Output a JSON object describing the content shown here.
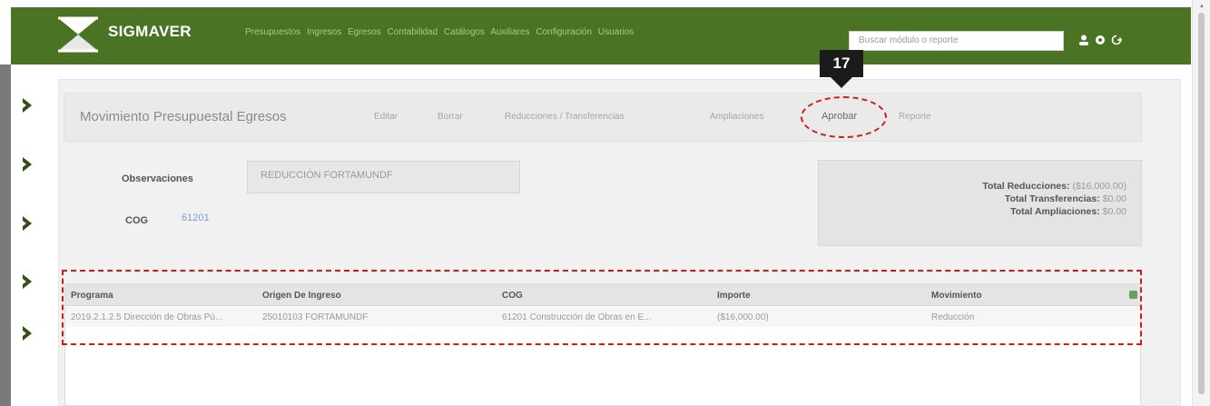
{
  "app": {
    "brand": "SIGMAVER",
    "nav_items": [
      "Presupuestos",
      "Ingresos",
      "Egresos",
      "Contabilidad",
      "Catálogos",
      "Auxiliares",
      "Configuración",
      "Usuarios"
    ],
    "search_placeholder": "Buscar módulo o reporte",
    "icons": [
      "user-icon",
      "gear-icon",
      "logout-icon"
    ],
    "accent_color": "#4a7423"
  },
  "page": {
    "title": "Movimiento Presupuestal Egresos",
    "menu": {
      "editar": "Editar",
      "borrar": "Borrar",
      "reducciones": "Reducciones / Transferencias",
      "ampliaciones": "Ampliaciones",
      "aprobar": "Aprobar",
      "reporte": "Reporte"
    }
  },
  "annotation": {
    "step_number": "17",
    "highlight_color": "#d11a1a"
  },
  "form": {
    "observaciones_label": "Observaciones",
    "observaciones_value": "REDUCCIÓN FORTAMUNDF",
    "cog_label": "COG",
    "cog_value": "61201"
  },
  "totals": {
    "reducciones_label": "Total Reducciones:",
    "reducciones_value": "($16,000.00)",
    "transferencias_label": "Total Transferencias:",
    "transferencias_value": "$0.00",
    "ampliaciones_label": "Total Ampliaciones:",
    "ampliaciones_value": "$0.00"
  },
  "table": {
    "columns": [
      "Programa",
      "Origen De Ingreso",
      "COG",
      "Importe",
      "Movimiento"
    ],
    "rows": [
      [
        "2019.2.1.2.5 Dirección de Obras Pú...",
        "25010103 FORTAMUNDF",
        "61201 Construcción de Obras en E...",
        "($16,000.00)",
        "Reducción"
      ]
    ]
  }
}
